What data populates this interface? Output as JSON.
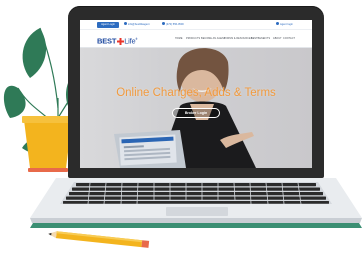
{
  "site": {
    "topbar": {
      "login_label": "Agent Login",
      "item_1": "info@bestlifeagent",
      "item_2": "(470) 556-0500",
      "search_label": "Agent login"
    },
    "logo": {
      "best": "BEST",
      "life": "Life",
      "trademark": "®"
    },
    "nav": [
      "HOME",
      "PRODUCTS",
      "BECOME AN AGENT",
      "FORMS & RESOURCES",
      "BESTBENEFITS",
      "ABOUT",
      "CONTACT"
    ],
    "hero": {
      "title": "Online Changes, Adds & Terms",
      "button_label": "Broker Login"
    }
  },
  "colors": {
    "brand_blue": "#2d6cc0",
    "logo_blue": "#1f4aa0",
    "logo_red": "#e8352b",
    "hero_title": "#f19a3e",
    "plant_leaf": "#2f7a57",
    "pot": "#f3b41e",
    "pencil": "#f3b41e"
  }
}
